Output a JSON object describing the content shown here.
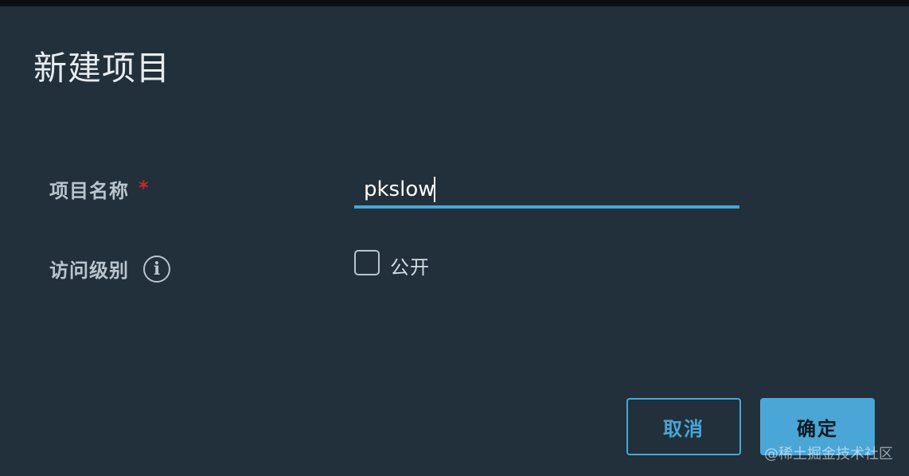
{
  "dialog": {
    "title": "新建项目"
  },
  "form": {
    "name_label": "项目名称",
    "required_mark": "*",
    "name_value": "pkslow",
    "access_label": "访问级别",
    "info_icon": "i",
    "public_label": "公开",
    "public_checked": false
  },
  "buttons": {
    "cancel": "取消",
    "ok": "确定"
  },
  "watermark": "@稀土掘金技术社区",
  "colors": {
    "background": "#21303b",
    "accent": "#49a6d6",
    "required": "#c62828"
  }
}
